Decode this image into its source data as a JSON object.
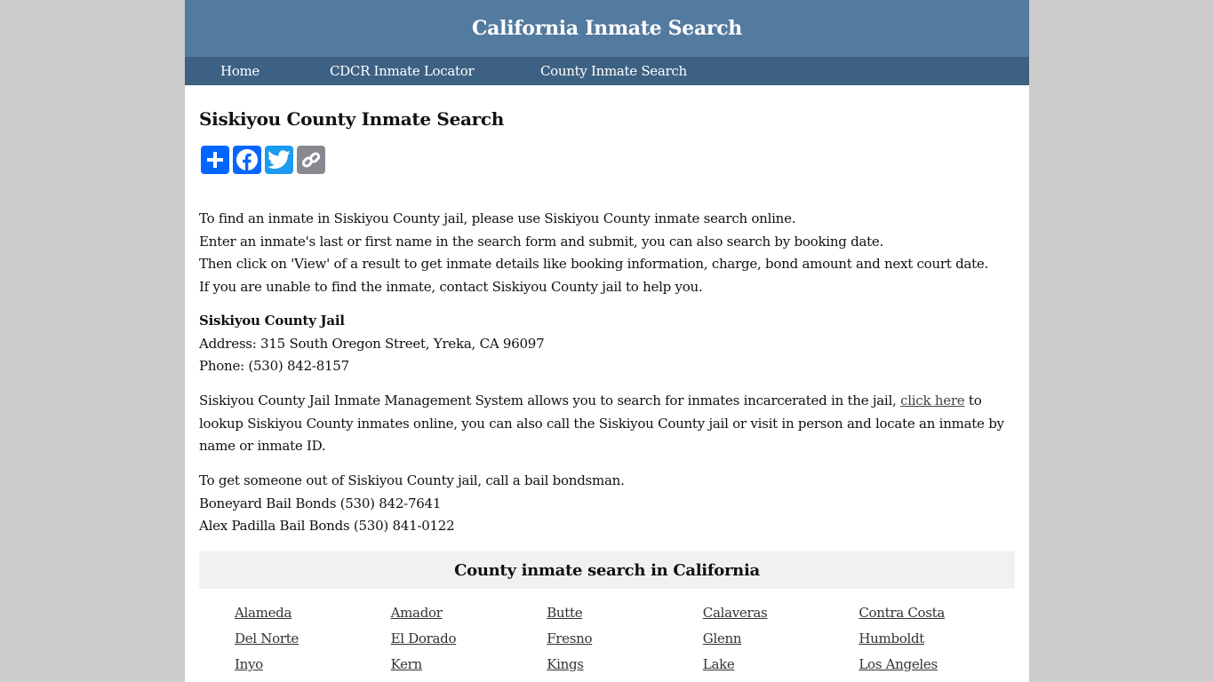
{
  "header": {
    "site_title": "California Inmate Search"
  },
  "nav": {
    "items": [
      {
        "label": "Home"
      },
      {
        "label": "CDCR Inmate Locator"
      },
      {
        "label": "County Inmate Search"
      }
    ]
  },
  "main": {
    "title": "Siskiyou County Inmate Search",
    "share_buttons": [
      {
        "icon": "plus-icon",
        "label": "Share",
        "color": "#0166ff"
      },
      {
        "icon": "facebook-icon",
        "label": "Facebook",
        "color": "#0866ff"
      },
      {
        "icon": "twitter-icon",
        "label": "Twitter",
        "color": "#1d9bf0"
      },
      {
        "icon": "link-icon",
        "label": "Copy Link",
        "color": "#888990"
      }
    ],
    "intro_lines": [
      "To find an inmate in Siskiyou County jail, please use Siskiyou County inmate search online.",
      "Enter an inmate's last or first name in the search form and submit, you can also search by booking date.",
      "Then click on 'View' of a result to get inmate details like booking information, charge, bond amount and next court date.",
      "If you are unable to find the inmate, contact Siskiyou County jail to help you."
    ],
    "jail": {
      "name": "Siskiyou County Jail",
      "address": "Address: 315 South Oregon Street, Yreka, CA 96097",
      "phone": "Phone: (530) 842-8157"
    },
    "ims": {
      "before_link": "Siskiyou County Jail Inmate Management System allows you to search for inmates incarcerated in the jail, ",
      "link_text": "click here",
      "after_link": " to lookup Siskiyou County inmates online, you can also call the Siskiyou County jail or visit in person and locate an inmate by name or inmate ID."
    },
    "bail": {
      "intro": "To get someone out of Siskiyou County jail, call a bail bondsman.",
      "bondsmen": [
        "Boneyard Bail Bonds (530) 842-7641",
        "Alex Padilla Bail Bonds (530) 841-0122"
      ]
    }
  },
  "counties": {
    "heading": "County inmate search in California",
    "links": [
      "Alameda",
      "Amador",
      "Butte",
      "Calaveras",
      "Contra Costa",
      "Del Norte",
      "El Dorado",
      "Fresno",
      "Glenn",
      "Humboldt",
      "Inyo",
      "Kern",
      "Kings",
      "Lake",
      "Los Angeles"
    ]
  },
  "colors": {
    "header_bg": "#537a9f",
    "nav_bg": "#3d6183",
    "page_bg": "#cccccc",
    "section_bg": "#f1f1f1"
  }
}
